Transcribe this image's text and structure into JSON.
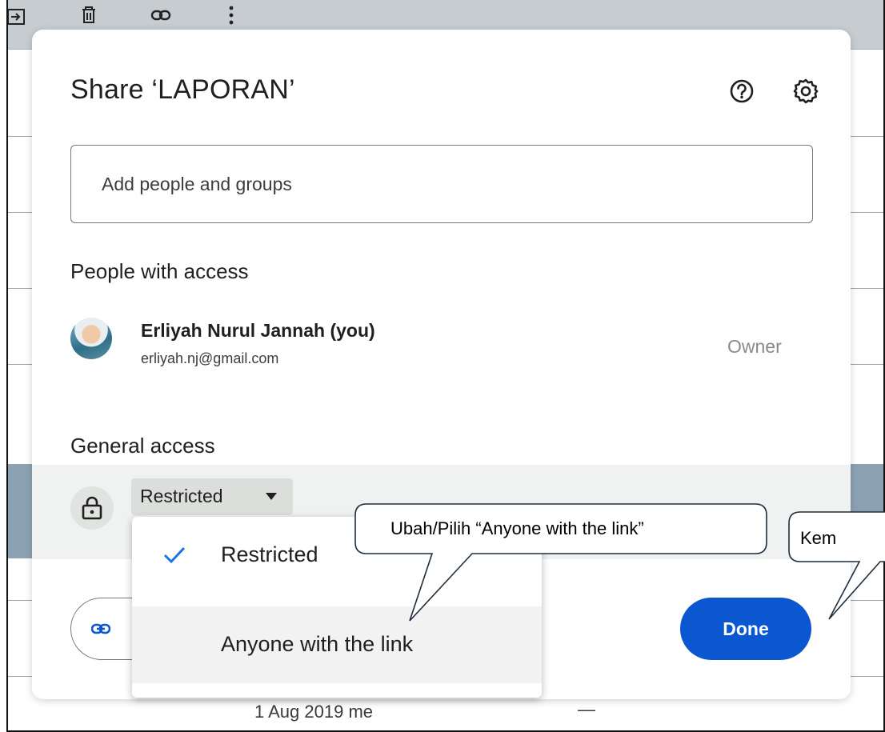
{
  "toolbar": {
    "icons": [
      "move-to-icon",
      "trash-icon",
      "link-icon",
      "more-vert-icon"
    ]
  },
  "dialog": {
    "title": "Share ‘LAPORAN’",
    "help_icon": "help-icon",
    "settings_icon": "gear-icon",
    "add_people_placeholder": "Add people and groups",
    "people_heading": "People with access",
    "person": {
      "name": "Erliyah Nurul Jannah (you)",
      "email": "erliyah.nj@gmail.com",
      "role": "Owner"
    },
    "general_heading": "General access",
    "access_value": "Restricted",
    "done_label": "Done",
    "copy_link_icon": "link-icon"
  },
  "dropdown": {
    "options": [
      {
        "label": "Restricted",
        "selected": true
      },
      {
        "label": "Anyone with the link",
        "selected": false
      }
    ]
  },
  "callouts": {
    "first": "Ubah/Pilih “Anyone with the link”",
    "second": "Kem"
  },
  "background": {
    "date": "1 Aug 2019",
    "owner": "me",
    "size": "—"
  },
  "colors": {
    "primary": "#0b57d0",
    "check": "#1a73e8",
    "toolbar": "#c7ccd0",
    "highlight_row": "#8ca2b3"
  }
}
